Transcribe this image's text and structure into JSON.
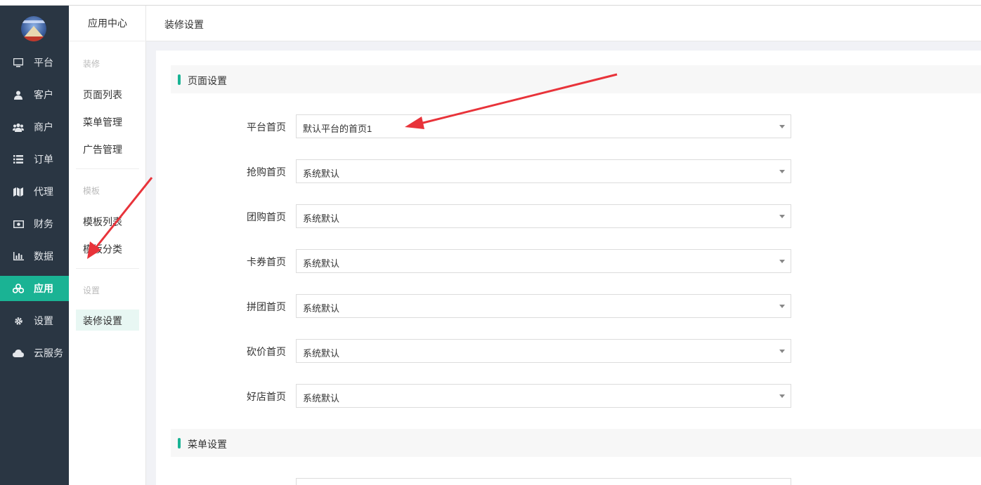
{
  "sidebar": {
    "items": [
      {
        "label": "平台",
        "icon": "monitor-icon"
      },
      {
        "label": "客户",
        "icon": "user-icon"
      },
      {
        "label": "商户",
        "icon": "users-icon"
      },
      {
        "label": "订单",
        "icon": "list-icon"
      },
      {
        "label": "代理",
        "icon": "map-icon"
      },
      {
        "label": "财务",
        "icon": "money-icon"
      },
      {
        "label": "数据",
        "icon": "bar-chart-icon"
      },
      {
        "label": "应用",
        "icon": "apps-icon",
        "active": true
      },
      {
        "label": "设置",
        "icon": "gear-icon"
      },
      {
        "label": "云服务",
        "icon": "cloud-icon"
      }
    ],
    "active_color": "#1ab394",
    "bg_color": "#2a3643"
  },
  "subnav": {
    "title": "应用中心",
    "group_decor": "装修",
    "decor_links": [
      "页面列表",
      "菜单管理",
      "广告管理"
    ],
    "group_template": "模板",
    "template_links": [
      "模板列表",
      "模板分类"
    ],
    "group_settings": "设置",
    "settings_link": "装修设置"
  },
  "header": {
    "title": "装修设置"
  },
  "page_section": {
    "title": "页面设置",
    "fields": [
      {
        "label": "平台首页",
        "value": "默认平台的首页1"
      },
      {
        "label": "抢购首页",
        "value": "系统默认"
      },
      {
        "label": "团购首页",
        "value": "系统默认"
      },
      {
        "label": "卡券首页",
        "value": "系统默认"
      },
      {
        "label": "拼团首页",
        "value": "系统默认"
      },
      {
        "label": "砍价首页",
        "value": "系统默认"
      },
      {
        "label": "好店首页",
        "value": "系统默认"
      }
    ]
  },
  "menu_section": {
    "title": "菜单设置"
  },
  "annotation_color": "#e8333a"
}
